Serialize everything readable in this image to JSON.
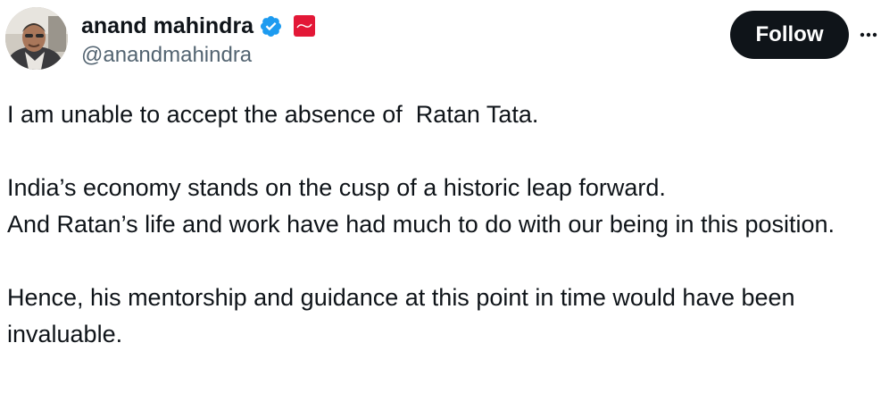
{
  "author": {
    "display_name": "anand mahindra",
    "handle": "@anandmahindra",
    "avatar_icon": "profile-photo",
    "verified_icon": "verified-badge-icon",
    "affiliate_icon": "mahindra-logo-badge",
    "verified_color": "#1d9bf0",
    "affiliate_color": "#e31837"
  },
  "actions": {
    "follow_label": "Follow",
    "more_icon": "more-options-icon"
  },
  "tweet": {
    "paragraphs": [
      "I am unable to accept the absence of  Ratan Tata.",
      "India’s economy stands on the cusp of a historic leap forward.\nAnd Ratan’s life and work have had much to do with our being in this position.",
      "Hence, his mentorship and guidance at this point in time would have been invaluable."
    ]
  },
  "colors": {
    "text_primary": "#0f1419",
    "text_secondary": "#536471",
    "button_bg": "#0f1419",
    "button_text": "#ffffff"
  }
}
